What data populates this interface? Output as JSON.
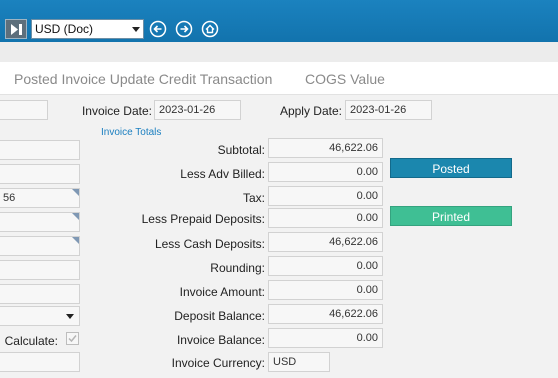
{
  "toolbar": {
    "currency": "USD (Doc)",
    "icons": [
      "end-button-icon",
      "previous-arrow-icon",
      "next-arrow-icon",
      "home-icon"
    ]
  },
  "tabs": [
    "Posted Invoice Update Credit Transaction",
    "COGS Value"
  ],
  "header": {
    "invoice_date_label": "Invoice Date:",
    "invoice_date": "2023-01-26",
    "apply_date_label": "Apply Date:",
    "apply_date": "2023-01-26"
  },
  "left_fields": {
    "partial_value": "56",
    "calculate_label": "Calculate:"
  },
  "totals": {
    "section_link": "Invoice Totals",
    "rows": [
      {
        "label": "Subtotal:",
        "value": "46,622.06"
      },
      {
        "label": "Less Adv Billed:",
        "value": "0.00"
      },
      {
        "label": "Tax:",
        "value": "0.00"
      },
      {
        "label": "Less Prepaid Deposits:",
        "value": "0.00"
      },
      {
        "label": "Less Cash Deposits:",
        "value": "46,622.06"
      },
      {
        "label": "Rounding:",
        "value": "0.00"
      },
      {
        "label": "Invoice Amount:",
        "value": "0.00"
      },
      {
        "label": "Deposit Balance:",
        "value": "46,622.06"
      },
      {
        "label": "Invoice Balance:",
        "value": "0.00"
      }
    ],
    "currency_label": "Invoice Currency:",
    "currency_value": "USD"
  },
  "statuses": [
    {
      "label": "Posted",
      "color": "#1b87ae"
    },
    {
      "label": "Printed",
      "color": "#3fbf94"
    }
  ],
  "colors": {
    "topbar": "#1478b5",
    "link": "#1b7fc0"
  }
}
